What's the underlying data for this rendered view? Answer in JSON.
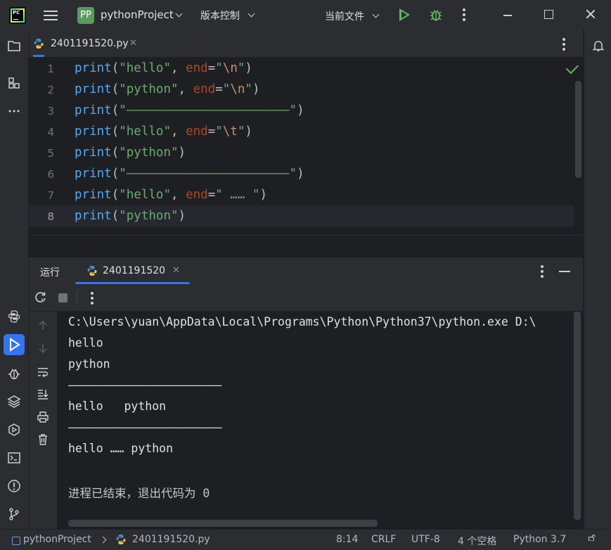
{
  "titlebar": {
    "app_logo_text": "PC",
    "project_badge": "PP",
    "project_name": "pythonProject",
    "vcs_label": "版本控制",
    "run_config": "当前文件"
  },
  "editor_tab": {
    "filename": "2401191520.py",
    "close": "✕"
  },
  "editor": {
    "line_numbers": [
      "1",
      "2",
      "3",
      "4",
      "5",
      "6",
      "7",
      "8"
    ],
    "current_line": 8,
    "lines": [
      [
        [
          "fn",
          "print"
        ],
        [
          "p",
          "("
        ],
        [
          "s",
          "\"hello\""
        ],
        [
          "p",
          ", "
        ],
        [
          "param",
          "end"
        ],
        [
          "p",
          "="
        ],
        [
          "s",
          "\""
        ],
        [
          "esc",
          "\\n"
        ],
        [
          "s",
          "\""
        ],
        [
          "p",
          ")"
        ]
      ],
      [
        [
          "fn",
          "print"
        ],
        [
          "p",
          "("
        ],
        [
          "s",
          "\"python\""
        ],
        [
          "p",
          ", "
        ],
        [
          "param",
          "end"
        ],
        [
          "p",
          "="
        ],
        [
          "s",
          "\""
        ],
        [
          "esc",
          "\\n"
        ],
        [
          "s",
          "\""
        ],
        [
          "p",
          ")"
        ]
      ],
      [
        [
          "fn",
          "print"
        ],
        [
          "p",
          "("
        ],
        [
          "s",
          "\"——————————————————————\""
        ],
        [
          "p",
          ")"
        ]
      ],
      [
        [
          "fn",
          "print"
        ],
        [
          "p",
          "("
        ],
        [
          "s",
          "\"hello\""
        ],
        [
          "p",
          ", "
        ],
        [
          "param",
          "end"
        ],
        [
          "p",
          "="
        ],
        [
          "s",
          "\""
        ],
        [
          "esc",
          "\\t"
        ],
        [
          "s",
          "\""
        ],
        [
          "p",
          ")"
        ]
      ],
      [
        [
          "fn",
          "print"
        ],
        [
          "p",
          "("
        ],
        [
          "s",
          "\"python\""
        ],
        [
          "p",
          ")"
        ]
      ],
      [
        [
          "fn",
          "print"
        ],
        [
          "p",
          "("
        ],
        [
          "s",
          "\"——————————————————————\""
        ],
        [
          "p",
          ")"
        ]
      ],
      [
        [
          "fn",
          "print"
        ],
        [
          "p",
          "("
        ],
        [
          "s",
          "\"hello\""
        ],
        [
          "p",
          ", "
        ],
        [
          "param",
          "end"
        ],
        [
          "p",
          "="
        ],
        [
          "s",
          "\" …… \""
        ],
        [
          "p",
          ")"
        ]
      ],
      [
        [
          "fn",
          "print"
        ],
        [
          "p",
          "("
        ],
        [
          "s",
          "\"python\""
        ],
        [
          "p",
          ")"
        ]
      ]
    ]
  },
  "run_panel": {
    "title": "运行",
    "tab_label": "2401191520",
    "close": "✕"
  },
  "console": {
    "lines": [
      "C:\\Users\\yuan\\AppData\\Local\\Programs\\Python\\Python37\\python.exe D:\\",
      "hello",
      "python",
      "——————————————————————",
      "hello\tpython",
      "——————————————————————",
      "hello …… python",
      "",
      "进程已结束，退出代码为 0"
    ]
  },
  "statusbar": {
    "project": "pythonProject",
    "file": "2401191520.py",
    "position": "8:14",
    "line_sep": "CRLF",
    "encoding": "UTF-8",
    "indent": "4 个空格",
    "interpreter": "Python 3.7"
  },
  "colors": {
    "accent": "#3574f0",
    "run_green": "#5fb865",
    "bg": "#1e1f22",
    "panel": "#2b2d30"
  }
}
